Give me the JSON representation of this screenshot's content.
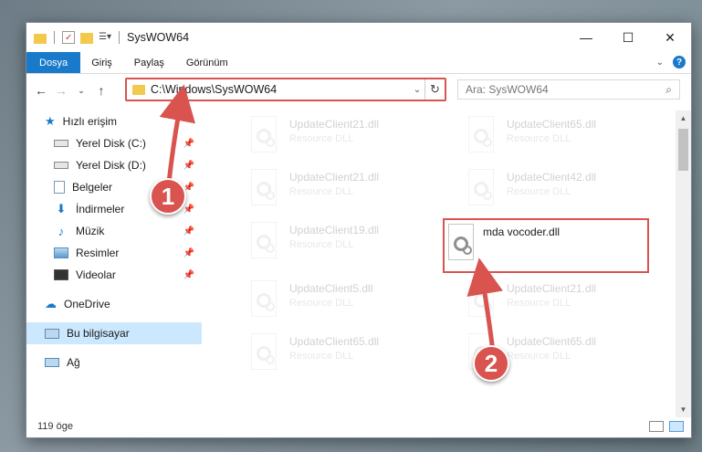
{
  "window": {
    "title": "SysWOW64",
    "controls": {
      "minimize": "—",
      "maximize": "☐",
      "close": "✕"
    }
  },
  "ribbon": {
    "tabs": [
      {
        "label": "Dosya"
      },
      {
        "label": "Giriş"
      },
      {
        "label": "Paylaş"
      },
      {
        "label": "Görünüm"
      }
    ]
  },
  "navigation": {
    "address_path": "C:\\Windows\\SysWOW64",
    "search_placeholder": "Ara: SysWOW64"
  },
  "sidebar": {
    "quick_access": {
      "label": "Hızlı erişim"
    },
    "items": [
      {
        "label": "Yerel Disk (C:)",
        "icon": "drive-icon"
      },
      {
        "label": "Yerel Disk (D:)",
        "icon": "drive-icon"
      },
      {
        "label": "Belgeler",
        "icon": "documents-icon"
      },
      {
        "label": "İndirmeler",
        "icon": "downloads-icon"
      },
      {
        "label": "Müzik",
        "icon": "music-icon"
      },
      {
        "label": "Resimler",
        "icon": "pictures-icon"
      },
      {
        "label": "Videolar",
        "icon": "videos-icon"
      }
    ],
    "onedrive": {
      "label": "OneDrive"
    },
    "this_pc": {
      "label": "Bu bilgisayar"
    },
    "network": {
      "label": "Ağ"
    }
  },
  "files": [
    {
      "name": "UpdateClient21.dll",
      "desc": "Resource DLL"
    },
    {
      "name": "UpdateClient65.dll",
      "desc": "Resource DLL"
    },
    {
      "name": "UpdateClient21.dll",
      "desc": "Resource DLL"
    },
    {
      "name": "UpdateClient42.dll",
      "desc": "Resource DLL"
    },
    {
      "name": "UpdateClient19.dll",
      "desc": "Resource DLL"
    },
    {
      "name": "mda vocoder.dll",
      "desc": ""
    },
    {
      "name": "UpdateClient5.dll",
      "desc": "Resource DLL"
    },
    {
      "name": "UpdateClient21.dll",
      "desc": "Resource DLL"
    },
    {
      "name": "UpdateClient65.dll",
      "desc": "Resource DLL"
    },
    {
      "name": "UpdateClient65.dll",
      "desc": "Resource DLL"
    }
  ],
  "status": {
    "item_count": "119 öge"
  },
  "callouts": {
    "first": "1",
    "second": "2"
  },
  "colors": {
    "accent": "#1979ca",
    "highlight": "#d9534f",
    "selected": "#cce8ff"
  }
}
